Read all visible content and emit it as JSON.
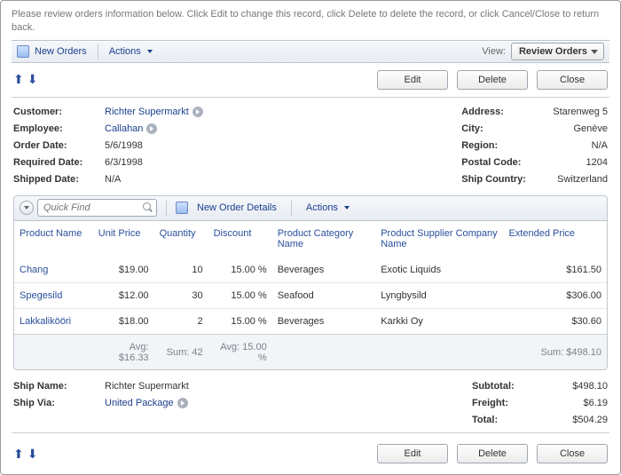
{
  "instructions": "Please review orders information below. Click Edit to change this record, click Delete to delete the record, or click Cancel/Close to return back.",
  "toolbar": {
    "new_orders": "New Orders",
    "actions": "Actions",
    "view_label": "View:",
    "view_selected": "Review Orders"
  },
  "buttons": {
    "edit": "Edit",
    "delete": "Delete",
    "close": "Close"
  },
  "fields_left": {
    "customer_lbl": "Customer:",
    "customer_val": "Richter Supermarkt",
    "employee_lbl": "Employee:",
    "employee_val": "Callahan",
    "orderdate_lbl": "Order Date:",
    "orderdate_val": "5/6/1998",
    "required_lbl": "Required Date:",
    "required_val": "6/3/1998",
    "shipped_lbl": "Shipped Date:",
    "shipped_val": "N/A"
  },
  "fields_right": {
    "address_lbl": "Address:",
    "address_val": "Starenweg 5",
    "city_lbl": "City:",
    "city_val": "Genève",
    "region_lbl": "Region:",
    "region_val": "N/A",
    "postal_lbl": "Postal Code:",
    "postal_val": "1204",
    "country_lbl": "Ship Country:",
    "country_val": "Switzerland"
  },
  "grid": {
    "quickfind_placeholder": "Quick Find",
    "new_details": "New Order Details",
    "actions": "Actions",
    "headers": {
      "product": "Product Name",
      "price": "Unit Price",
      "qty": "Quantity",
      "discount": "Discount",
      "category": "Product Category Name",
      "supplier": "Product Supplier Company Name",
      "ext": "Extended Price"
    },
    "rows": [
      {
        "product": "Chang",
        "price": "$19.00",
        "qty": "10",
        "discount": "15.00 %",
        "category": "Beverages",
        "supplier": "Exotic Liquids",
        "ext": "$161.50"
      },
      {
        "product": "Spegesild",
        "price": "$12.00",
        "qty": "30",
        "discount": "15.00 %",
        "category": "Seafood",
        "supplier": "Lyngbysild",
        "ext": "$306.00"
      },
      {
        "product": "Lakkalikööri",
        "price": "$18.00",
        "qty": "2",
        "discount": "15.00 %",
        "category": "Beverages",
        "supplier": "Karkki Oy",
        "ext": "$30.60"
      }
    ],
    "footer": {
      "price_avg": "Avg: $16.33",
      "qty_sum": "Sum: 42",
      "discount_avg": "Avg: 15.00 %",
      "ext_sum": "Sum: $498.10"
    }
  },
  "totals_left": {
    "shipname_lbl": "Ship Name:",
    "shipname_val": "Richter Supermarkt",
    "shipvia_lbl": "Ship Via:",
    "shipvia_val": "United Package"
  },
  "totals_right": {
    "subtotal_lbl": "Subtotal:",
    "subtotal_val": "$498.10",
    "freight_lbl": "Freight:",
    "freight_val": "$6.19",
    "total_lbl": "Total:",
    "total_val": "$504.29"
  }
}
